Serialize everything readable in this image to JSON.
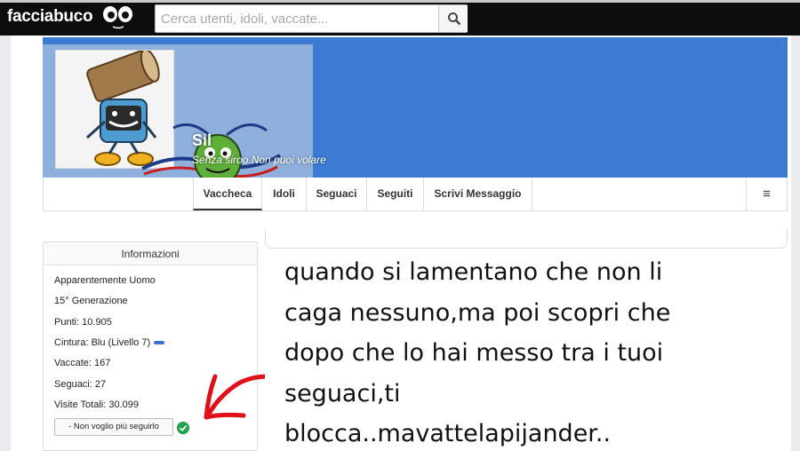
{
  "topbar": {
    "logo": "facciabuco",
    "search_placeholder": "Cerca utenti, idoli, vaccate..."
  },
  "profile": {
    "name": "Sil",
    "motto": "Senza siroo Non puoi volare"
  },
  "nav": {
    "tabs": [
      "Vaccheca",
      "Idoli",
      "Seguaci",
      "Seguiti",
      "Scrivi Messaggio"
    ],
    "menu_symbol": "≡"
  },
  "info": {
    "title": "Informazioni",
    "rows": [
      "Apparentemente Uomo",
      "15° Generazione",
      "Punti: 10.905",
      "Cintura: Blu (Livello 7)",
      "Vaccate: 167",
      "Seguaci: 27",
      "Visite Totali: 30.099"
    ],
    "unfollow_button": "- Non voglio più seguirlo"
  },
  "post": {
    "lines": [
      "quando si lamentano che non li",
      "caga nessuno,ma poi scopri che",
      "dopo che lo hai messo tra i tuoi",
      "seguaci,ti",
      "blocca..mavattelapijander.."
    ]
  },
  "colors": {
    "topbar": "#0d0d0d",
    "cover": "#3b7bd4",
    "arrow": "#e0101a",
    "belt": "#3a6fd8",
    "check": "#22a34a"
  }
}
